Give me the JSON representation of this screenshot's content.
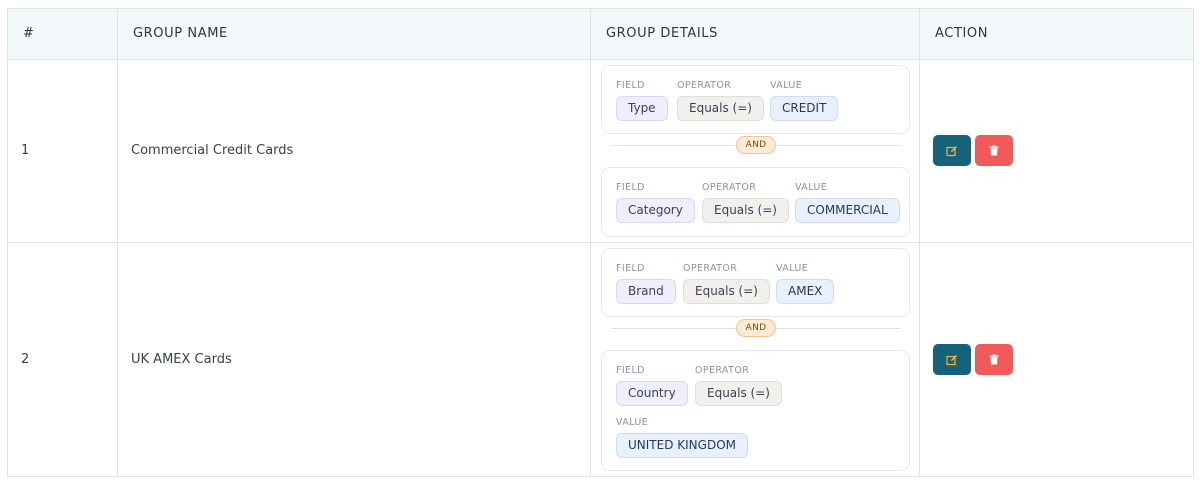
{
  "columns": {
    "index": "#",
    "group_name": "GROUP NAME",
    "group_details": "GROUP DETAILS",
    "action": "ACTION"
  },
  "connector": "AND",
  "rows": [
    {
      "index": "1",
      "group_name": "Commercial Credit Cards",
      "conditions": [
        {
          "field_label": "FIELD",
          "operator_label": "OPERATOR",
          "value_label": "VALUE",
          "field": "Type",
          "operator": "Equals (=)",
          "value": "CREDIT"
        },
        {
          "field_label": "FIELD",
          "operator_label": "OPERATOR",
          "value_label": "VALUE",
          "field": "Category",
          "operator": "Equals (=)",
          "value": "COMMERCIAL"
        }
      ]
    },
    {
      "index": "2",
      "group_name": "UK AMEX Cards",
      "conditions": [
        {
          "field_label": "FIELD",
          "operator_label": "OPERATOR",
          "value_label": "VALUE",
          "field": "Brand",
          "operator": "Equals (=)",
          "value": "AMEX"
        },
        {
          "field_label": "FIELD",
          "operator_label": "OPERATOR",
          "value_label": "VALUE",
          "field": "Country",
          "operator": "Equals (=)",
          "value": "UNITED KINGDOM"
        }
      ]
    }
  ],
  "colors": {
    "edit_button": "#15627a",
    "delete_button": "#f25a5a",
    "edit_icon": "#f6b23a",
    "header_bg": "#f3f8fb"
  },
  "icons": {
    "edit": "edit-icon",
    "delete": "trash-icon"
  }
}
